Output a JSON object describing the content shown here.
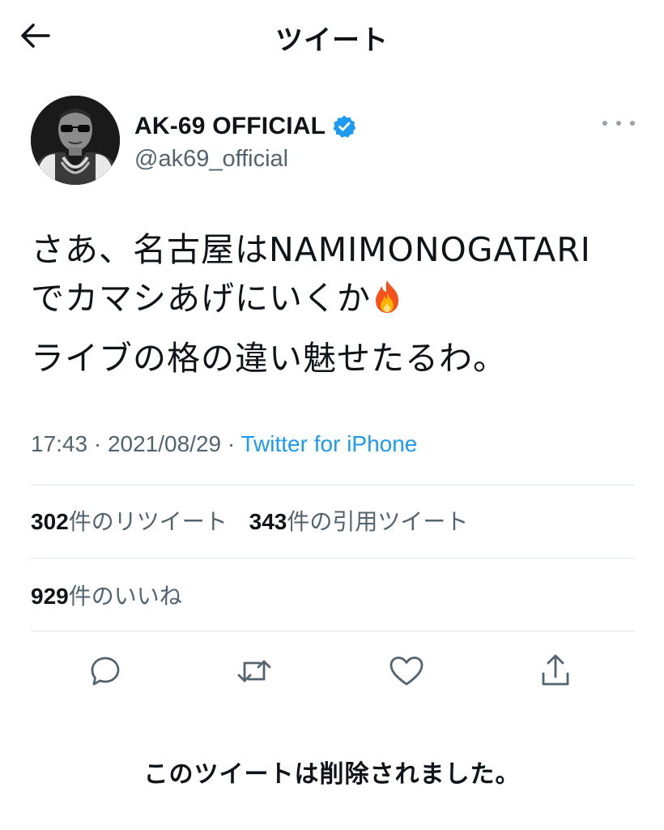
{
  "header": {
    "title": "ツイート",
    "back_icon": "arrow-left-icon"
  },
  "tweet": {
    "display_name": "AK-69 OFFICIAL",
    "handle": "@ak69_official",
    "verified": true,
    "text_lines": [
      "さあ、名古屋はNAMIMONOGATARI",
      "でカマシあげにいくか",
      "ライブの格の違い魅せたるわ。"
    ],
    "time": "17:43",
    "separator": " · ",
    "date": "2021/08/29",
    "source": "Twitter for iPhone"
  },
  "stats": {
    "retweets_count": "302",
    "retweets_label": "件のリツイート",
    "quotes_count": "343",
    "quotes_label": "件の引用ツイート",
    "likes_count": "929",
    "likes_label": "件のいいね"
  },
  "actions": [
    "reply-icon",
    "retweet-icon",
    "like-icon",
    "share-icon"
  ],
  "notice": "このツイートは削除されました。",
  "colors": {
    "link": "#1d9bf0",
    "secondary": "#536471",
    "divider": "#e1e6ea",
    "text": "#0f1419"
  }
}
